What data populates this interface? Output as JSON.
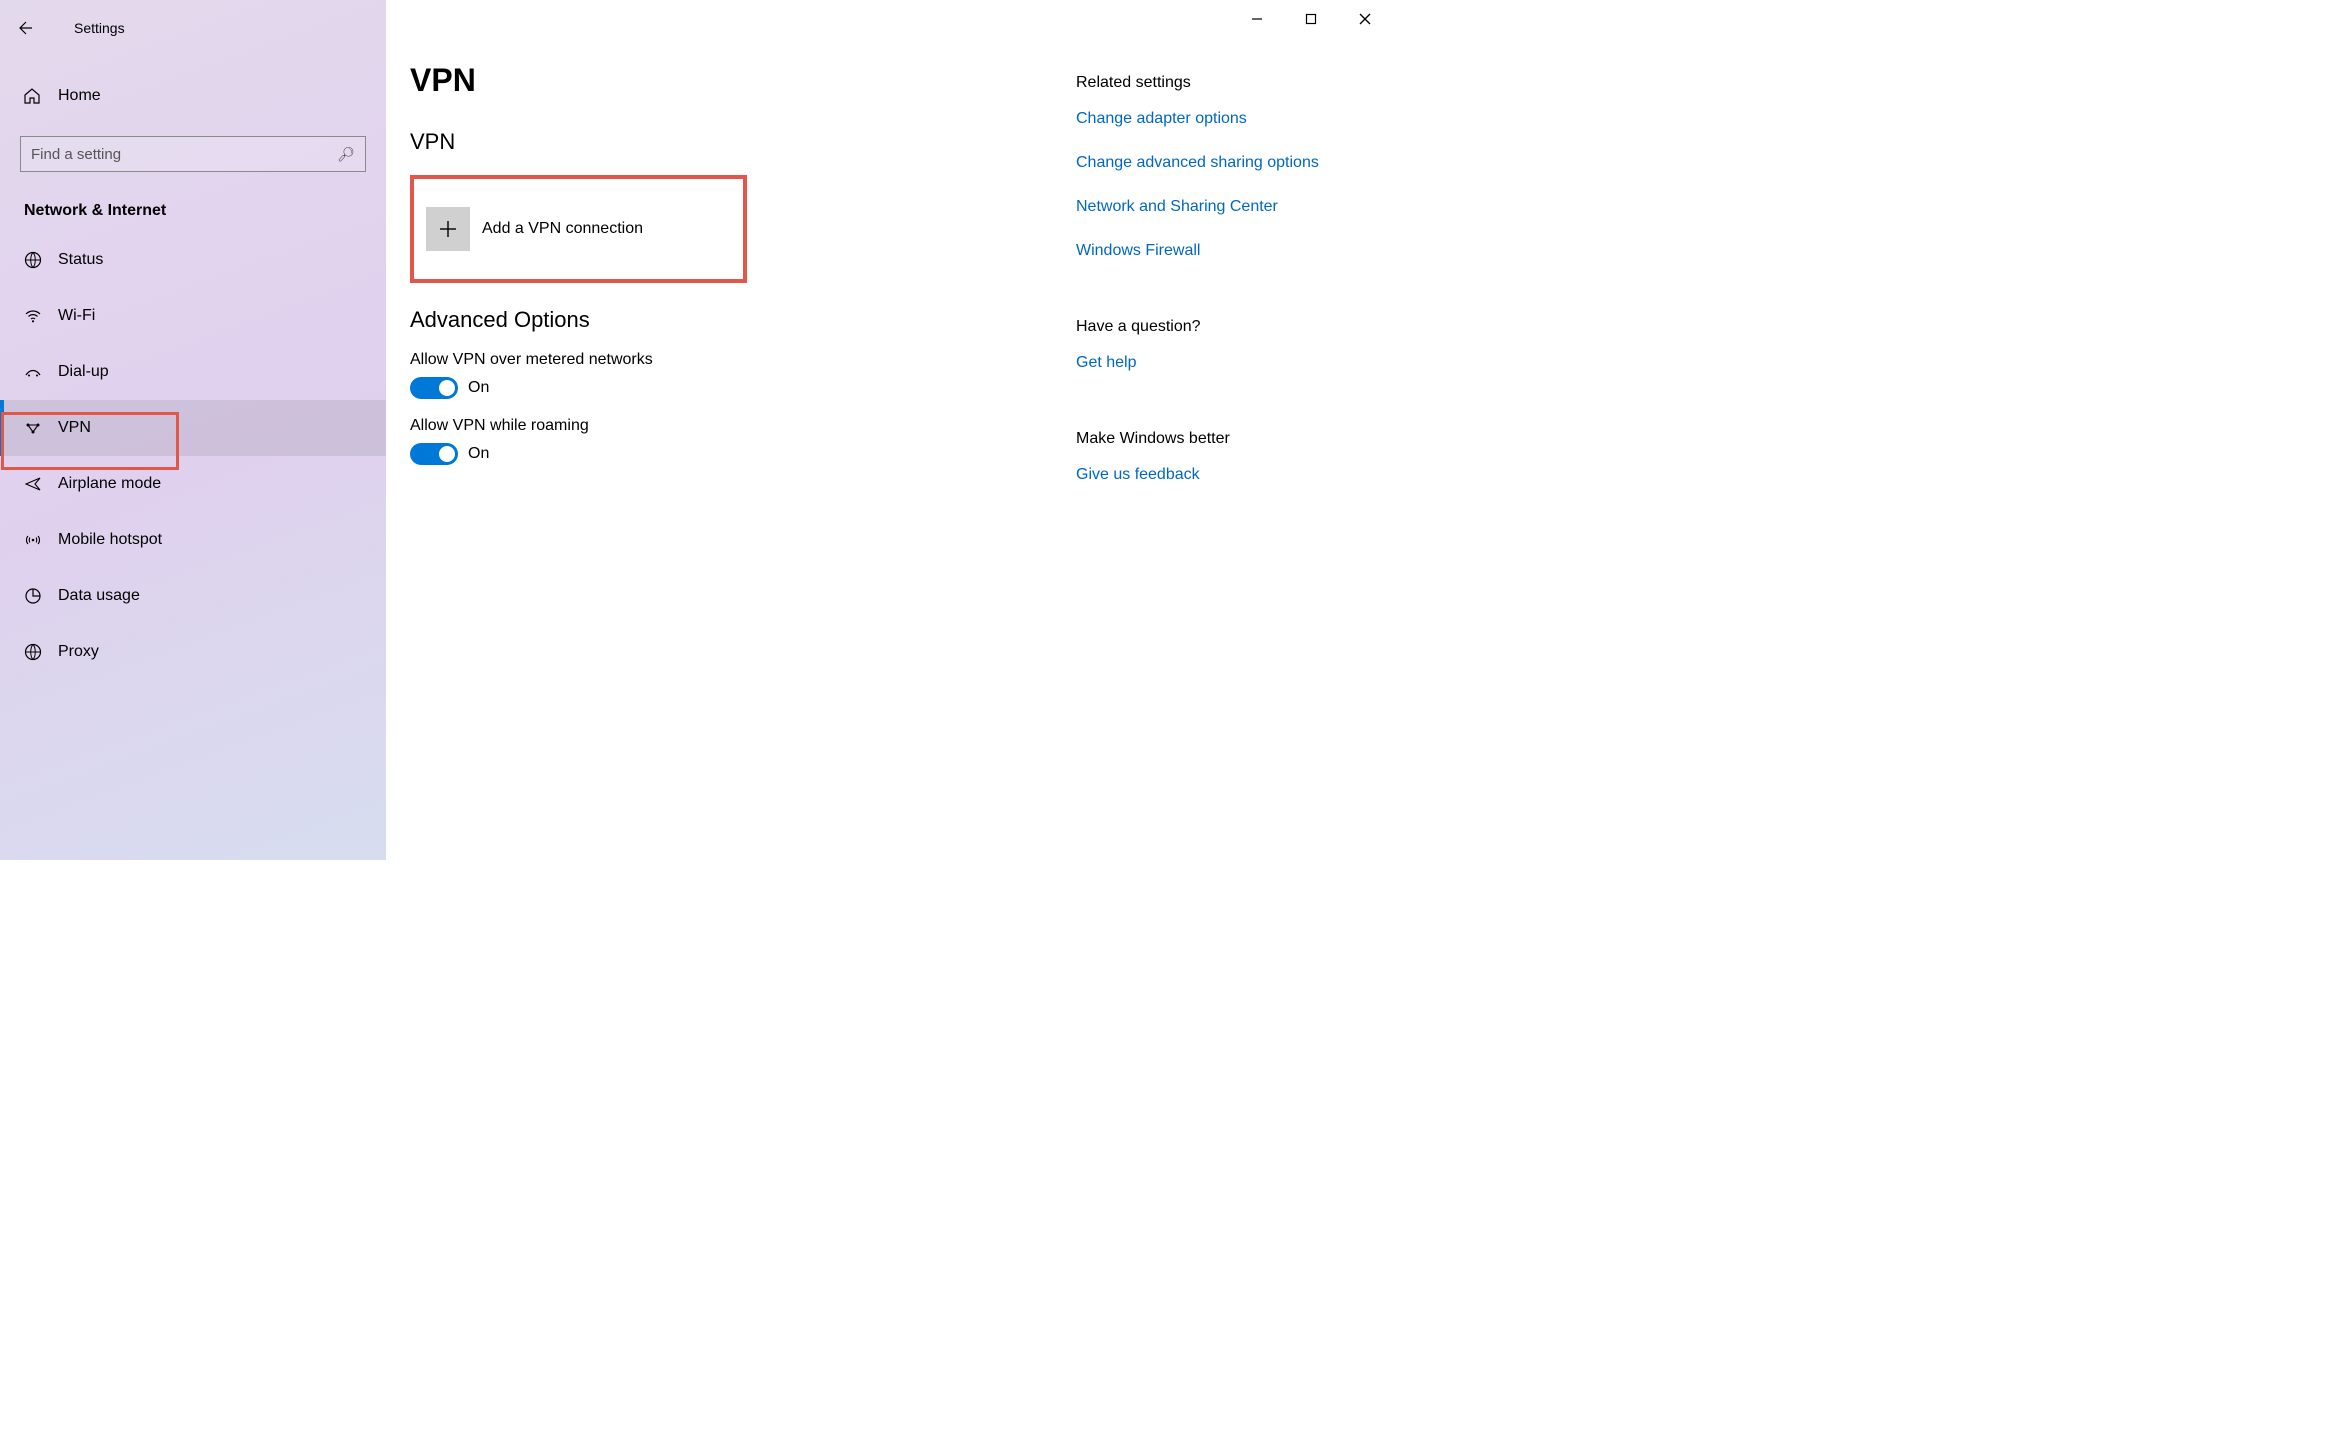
{
  "window": {
    "title": "Settings"
  },
  "sidebar": {
    "home": "Home",
    "search_placeholder": "Find a setting",
    "section": "Network & Internet",
    "items": [
      {
        "label": "Status"
      },
      {
        "label": "Wi-Fi"
      },
      {
        "label": "Dial-up"
      },
      {
        "label": "VPN"
      },
      {
        "label": "Airplane mode"
      },
      {
        "label": "Mobile hotspot"
      },
      {
        "label": "Data usage"
      },
      {
        "label": "Proxy"
      }
    ]
  },
  "page": {
    "title": "VPN",
    "subheader": "VPN",
    "add_label": "Add a VPN connection",
    "advanced_heading": "Advanced Options",
    "toggle_metered": {
      "label": "Allow VPN over metered networks",
      "state": "On"
    },
    "toggle_roaming": {
      "label": "Allow VPN while roaming",
      "state": "On"
    }
  },
  "rail": {
    "related_heading": "Related settings",
    "related_links": [
      "Change adapter options",
      "Change advanced sharing options",
      "Network and Sharing Center",
      "Windows Firewall"
    ],
    "question_heading": "Have a question?",
    "help_link": "Get help",
    "feedback_heading": "Make Windows better",
    "feedback_link": "Give us feedback"
  }
}
